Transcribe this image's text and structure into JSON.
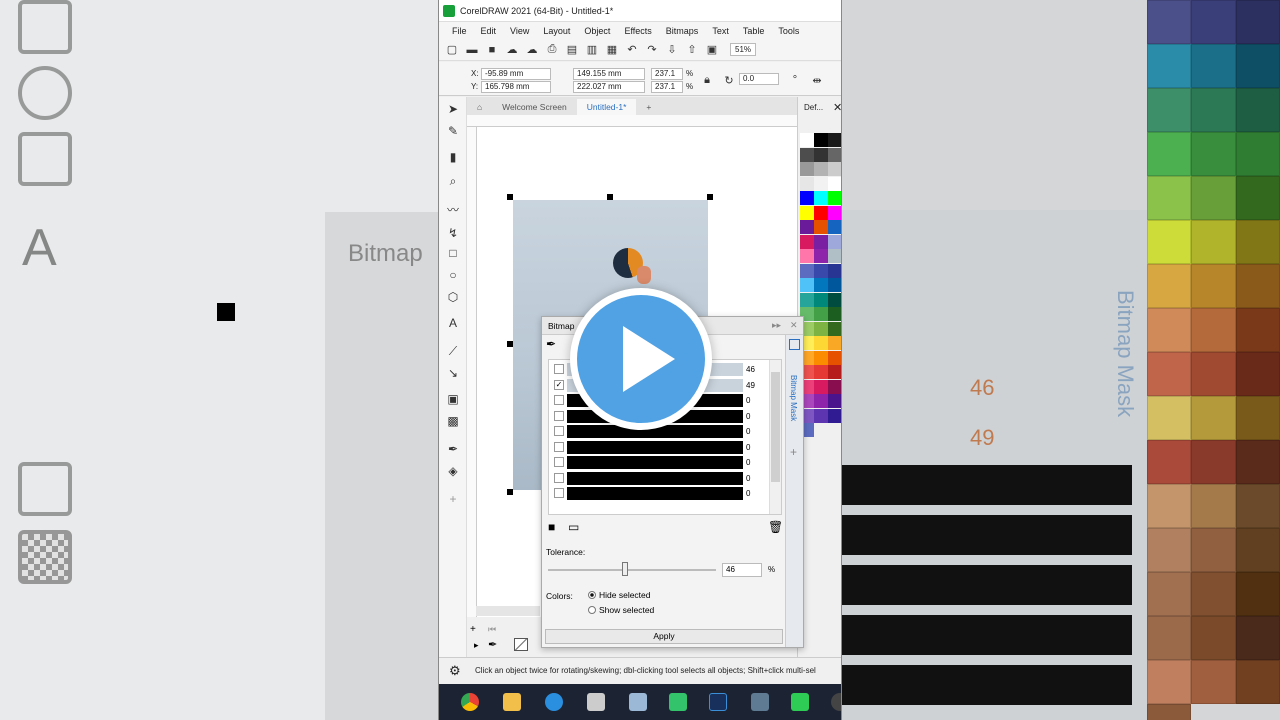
{
  "window": {
    "title": "CorelDRAW 2021 (64-Bit) - Untitled-1*"
  },
  "menu": [
    "File",
    "Edit",
    "View",
    "Layout",
    "Object",
    "Effects",
    "Bitmaps",
    "Text",
    "Table",
    "Tools"
  ],
  "toolbar": {
    "zoom": "51%"
  },
  "properties": {
    "x_label": "X:",
    "x_value": "-95.89 mm",
    "y_label": "Y:",
    "y_value": "165.798 mm",
    "width_value": "149.155 mm",
    "height_value": "222.027 mm",
    "scale_x": "237.1",
    "scale_y": "237.1",
    "percent": "%",
    "rotation": "0.0"
  },
  "tabs": {
    "welcome": "Welcome Screen",
    "document": "Untitled-1*",
    "add": "+"
  },
  "docker": {
    "title": "Bitmap",
    "side_label": "Bitmap Mask",
    "tolerances": [
      "46",
      "49",
      "0",
      "0",
      "0",
      "0",
      "0",
      "0",
      "0"
    ],
    "checked": [
      false,
      true,
      false,
      false,
      false,
      false,
      false,
      false,
      false
    ],
    "tolerance_label": "Tolerance:",
    "tolerance_value": "46",
    "tolerance_unit": "%",
    "colors_label": "Colors:",
    "hide_selected": "Hide selected",
    "show_selected": "Show selected",
    "selected_mode": "hide",
    "apply": "Apply"
  },
  "palette": {
    "label": "Def..."
  },
  "status": {
    "hint": "Click an object twice for rotating/skewing; dbl-clicking tool selects all objects; Shift+click multi-sel"
  },
  "colors": {
    "accent": "#2a6fc0",
    "play_button": "#50a2e4",
    "taskbar": "#1c2333"
  }
}
